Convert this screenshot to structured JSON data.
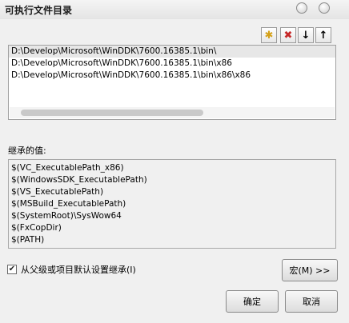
{
  "window": {
    "title": "可执行文件目录"
  },
  "toolbar": {
    "new_icon": "new-folder-icon",
    "delete_icon": "delete-icon",
    "down_icon": "arrow-down-icon",
    "up_icon": "arrow-up-icon",
    "new_glyph": "✱",
    "delete_glyph": "✖",
    "down_glyph": "↓",
    "up_glyph": "↑",
    "delete_color": "#c62828"
  },
  "paths": [
    "D:\\Develop\\Microsoft\\WinDDK\\7600.16385.1\\bin\\",
    "D:\\Develop\\Microsoft\\WinDDK\\7600.16385.1\\bin\\x86",
    "D:\\Develop\\Microsoft\\WinDDK\\7600.16385.1\\bin\\x86\\x86"
  ],
  "inherited": {
    "label": "继承的值:",
    "values": [
      "$(VC_ExecutablePath_x86)",
      "$(WindowsSDK_ExecutablePath)",
      "$(VS_ExecutablePath)",
      "$(MSBuild_ExecutablePath)",
      "$(SystemRoot)\\SysWow64",
      "$(FxCopDir)",
      "$(PATH)"
    ]
  },
  "inherit_checkbox": {
    "label": "从父级或项目默认设置继承(I)",
    "checked": true,
    "check_glyph": "✔"
  },
  "buttons": {
    "macro": "宏(M) >>",
    "ok": "确定",
    "cancel": "取消"
  }
}
